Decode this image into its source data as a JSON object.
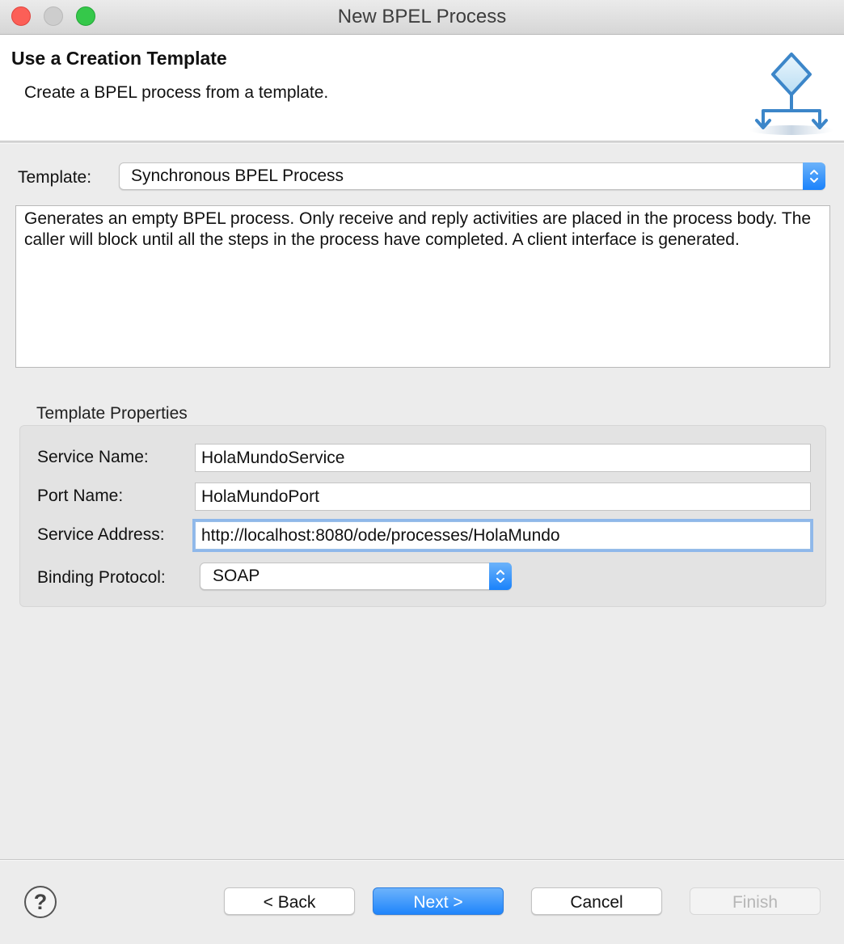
{
  "window": {
    "title": "New BPEL Process"
  },
  "banner": {
    "title": "Use a Creation Template",
    "description": "Create a BPEL process from a template.",
    "icon": "bpel-process-diagram-icon"
  },
  "template": {
    "label": "Template:",
    "selected": "Synchronous BPEL Process",
    "description": "Generates an empty BPEL process. Only receive and reply activities are placed in the process body. The caller will block until all the steps in the process have completed. A client interface is generated."
  },
  "properties": {
    "group_title": "Template Properties",
    "service_name": {
      "label": "Service Name:",
      "value": "HolaMundoService"
    },
    "port_name": {
      "label": "Port Name:",
      "value": "HolaMundoPort"
    },
    "service_address": {
      "label": "Service Address:",
      "value": "http://localhost:8080/ode/processes/HolaMundo"
    },
    "binding_protocol": {
      "label": "Binding Protocol:",
      "selected": "SOAP"
    }
  },
  "footer": {
    "help_icon": "help-icon",
    "back_label": "< Back",
    "next_label": "Next >",
    "cancel_label": "Cancel",
    "finish_label": "Finish"
  },
  "colors": {
    "accent": "#1f85fb",
    "focus_ring": "#8fb8ea",
    "close": "#fc5f57",
    "maximize": "#35c84a"
  }
}
